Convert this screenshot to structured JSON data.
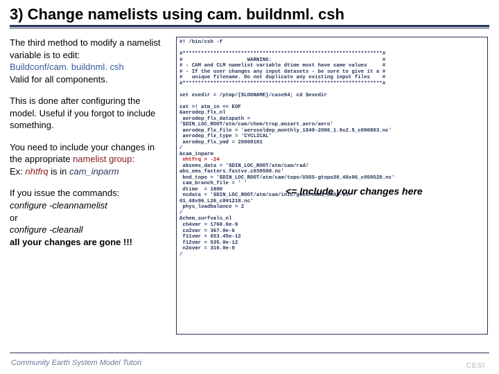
{
  "title": "3) Change namelists using cam. buildnml. csh",
  "left": {
    "p1a": "The third method to modify a namelist variable is to edit:",
    "p1b": "Buildconf/cam. buildnml. csh",
    "p1c": "Valid for all components.",
    "p2": "This is done after configuring the model. Useful if you forgot to include something.",
    "p3a": "You need to include your changes in the appropriate ",
    "p3b": "namelist group",
    "p3c": ":",
    "p3d": "Ex: ",
    "p3e": "nhtfrq",
    "p3f": " is in ",
    "p3g": "cam_inparm",
    "p4a": "If you issue the commands:",
    "p4b": "configure -cleannamelist",
    "p4c": "or",
    "p4d": "configure -cleanall",
    "p4e": "all your changes are gone !!!"
  },
  "code": {
    "line1": "#! /bin/csh -f",
    "blank": "",
    "w1": "#*****************************************************************#",
    "w2": "#                     WARNING:                                    #",
    "w3": "# - CAM and CLM namelist variable dtime must have same values     #",
    "w4": "# - If the user changes any input datasets - be sure to give it a #",
    "w5": "#   unique filename. Do not duplicate any existing input files    #",
    "w6": "#*****************************************************************#",
    "s1": "set exedir = /ptmp/{$LOGNAME}/case04; cd $exedir",
    "c1": "cat >! atm_in << EOF",
    "c2": "&aerodep_flx_nl",
    "c3": " aerodep_flx_datapath =",
    "c4": "'$DIN_LOC_ROOT/atm/cam/chem/trop_mozart_aero/aero'",
    "c5": " aerodep_flx_file = 'aerosoldep_monthly_1849-2006_1.9x2.5_c090803.nc'",
    "c6": " aerodep_flx_type = 'CYCLICAL'",
    "c7": " aerodep_flx_ymd = 20000101",
    "c8": "/",
    "c9": "&cam_inparm",
    "c10r": " nhtfrq = -24",
    "c11": " absems_data = '$DIN_LOC_ROOT/atm/cam/rad/",
    "c12": "abs_ems_factors_fastvx.c030508.nc'",
    "c13": " bnd_topo = '$DIN_LOC_ROOT/atm/cam/topo/USGS-gtopo30_48x96_c050520.nc'",
    "c14": " cam_branch_file = ' '",
    "c15": " dtime  = 1800",
    "c16": " ncdata = '$DIN_LOC_ROOT/atm/cam/inic/gaus/cami_0000-01-",
    "c17": "01_48x96_L26_c091218.nc'",
    "c18": " phys_loadbalance = 2",
    "c19": "/",
    "c20": "&chem_surfvals_nl",
    "c21": " ch4vmr = 1760.0e-9",
    "c22": " co2vmr = 367.0e-6",
    "c23": " f11vmr = 653.45e-12",
    "c24": " f12vmr = 535.0e-12",
    "c25": " n2ovmr = 316.0e-9",
    "c26": "/"
  },
  "annot": "<= Include your changes here",
  "footer": "Community Earth System Model Tutori",
  "logo": "CESI"
}
